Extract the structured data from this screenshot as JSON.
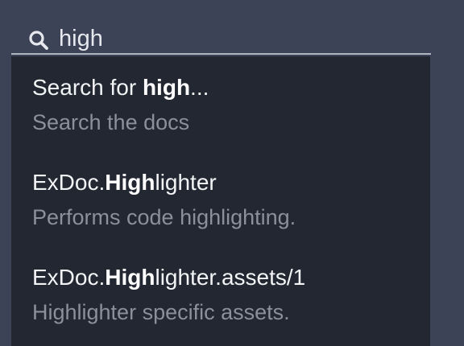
{
  "search": {
    "value": "high",
    "icon": "search-icon"
  },
  "results": [
    {
      "title_prefix": "Search for ",
      "title_match": "high",
      "title_suffix": "...",
      "description": "Search the docs"
    },
    {
      "title_prefix": "ExDoc.",
      "title_match": "High",
      "title_suffix": "lighter",
      "description": "Performs code highlighting."
    },
    {
      "title_prefix": "ExDoc.",
      "title_match": "High",
      "title_suffix": "lighter.assets/1",
      "description": "Highlighter specific assets."
    }
  ],
  "colors": {
    "page_background": "#3c4356",
    "dropdown_background": "#222731",
    "title_text": "#f2f3f5",
    "description_text": "#8a909c",
    "underline": "#aeb4c0"
  }
}
